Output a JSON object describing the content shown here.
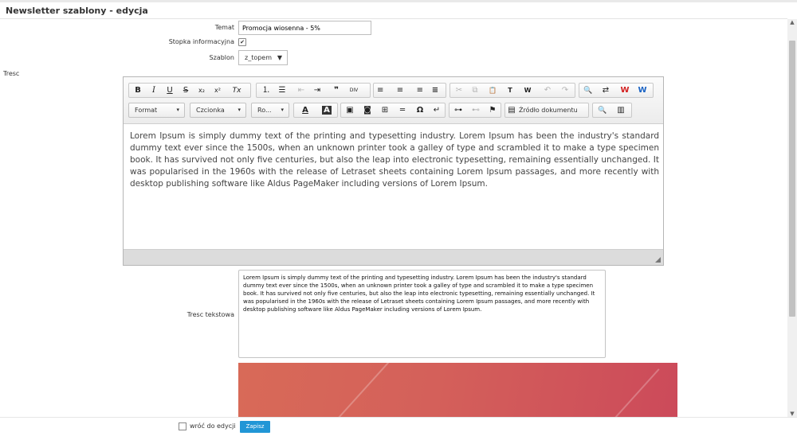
{
  "page": {
    "title": "Newsletter szablony - edycja"
  },
  "form": {
    "temat_label": "Temat",
    "temat_value": "Promocja wiosenna - 5%",
    "stopka_label": "Stopka informacyjna",
    "stopka_checked": "✔",
    "szablon_label": "Szablon",
    "szablon_value": "z_topem",
    "tresc_label": "Tresc",
    "tresc_tekstowa_label": "Tresc tekstowa"
  },
  "editor": {
    "format_label": "Format",
    "font_label": "Czcionka",
    "size_label": "Ro...",
    "source_label": "Źródło dokumentu",
    "content": "Lorem Ipsum is simply dummy text of the printing and typesetting industry. Lorem Ipsum has been the industry's standard dummy text ever since the 1500s, when an unknown printer took a galley of type and scrambled it to make a type specimen book. It has survived not only five centuries, but also the leap into electronic typesetting, remaining essentially unchanged. It was popularised in the 1960s with the release of Letraset sheets containing Lorem Ipsum passages, and more recently with desktop publishing software like Aldus PageMaker including versions of Lorem Ipsum."
  },
  "plain_text": "Lorem Ipsum is simply dummy text of the printing and typesetting industry. Lorem Ipsum has been the industry's standard dummy text ever since the 1500s, when an unknown printer took a galley of type and scrambled it to make a type specimen book. It has survived not only five centuries, but also the leap into electronic typesetting, remaining essentially unchanged. It was popularised in the 1960s with the release of Letraset sheets containing Lorem Ipsum passages, and more recently with desktop publishing software like Aldus PageMaker including versions of Lorem Ipsum.",
  "footer": {
    "back_label": "wróć do edycji",
    "save_label": "Zapisz"
  },
  "colors": {
    "accent": "#2196d6",
    "banner": "#d4605a"
  },
  "icons": {
    "bold": "B",
    "italic": "I",
    "underline": "U",
    "strike": "S",
    "subscript": "x₂",
    "superscript": "x²",
    "remove_format": "Tx",
    "numbered_list": "⒈",
    "bullet_list": "☰",
    "outdent": "⇤",
    "indent": "⇥",
    "blockquote": "❞",
    "div": "DIV",
    "align_left": "≡",
    "align_center": "≡",
    "align_right": "≡",
    "justify": "≡",
    "cut": "✂",
    "copy": "⧉",
    "paste": "📋",
    "paste_text": "T",
    "paste_word": "W",
    "undo": "↶",
    "redo": "↷",
    "find": "🔍",
    "replace": "⇄",
    "spell": "W",
    "scayt": "W",
    "text_color": "A",
    "bg_color": "A",
    "image": "▣",
    "flash": "◙",
    "table": "⊞",
    "hr": "═",
    "special_char": "Ω",
    "pagebreak": "↵",
    "link": "⊶",
    "unlink": "⊷",
    "anchor": "⚑",
    "source": "▤",
    "preview": "🔍",
    "templates": "▥"
  }
}
